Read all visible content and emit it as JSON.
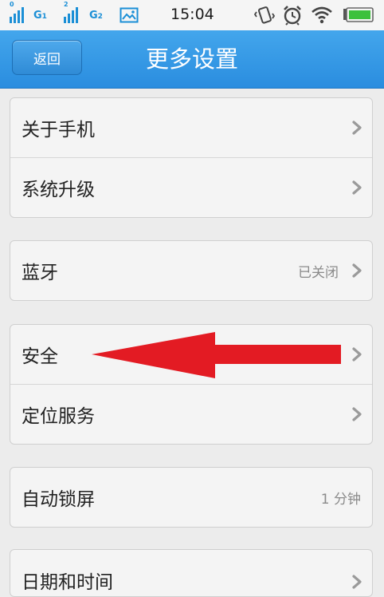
{
  "status_bar": {
    "sim1_label": "G",
    "sim1_sub": "1",
    "sim2_label": "G",
    "sim2_sub": "2",
    "time": "15:04",
    "icons": [
      "signal-icon",
      "signal-icon",
      "image-icon",
      "vibrate-icon",
      "alarm-icon",
      "wifi-icon",
      "battery-icon"
    ]
  },
  "header": {
    "back_label": "返回",
    "title": "更多设置"
  },
  "groups": [
    {
      "items": [
        {
          "label": "关于手机",
          "value": "",
          "chevron": true
        },
        {
          "label": "系统升级",
          "value": "",
          "chevron": true
        }
      ]
    },
    {
      "items": [
        {
          "label": "蓝牙",
          "value": "已关闭",
          "chevron": true
        }
      ]
    },
    {
      "items": [
        {
          "label": "安全",
          "value": "",
          "chevron": true
        },
        {
          "label": "定位服务",
          "value": "",
          "chevron": true
        }
      ]
    },
    {
      "items": [
        {
          "label": "自动锁屏",
          "value": "1 分钟",
          "chevron": false
        }
      ]
    },
    {
      "items": [
        {
          "label": "日期和时间",
          "value": "",
          "chevron": true
        }
      ]
    }
  ],
  "colors": {
    "accent": "#2f93e0",
    "annotation": "#e31b23",
    "background": "#ececec"
  }
}
